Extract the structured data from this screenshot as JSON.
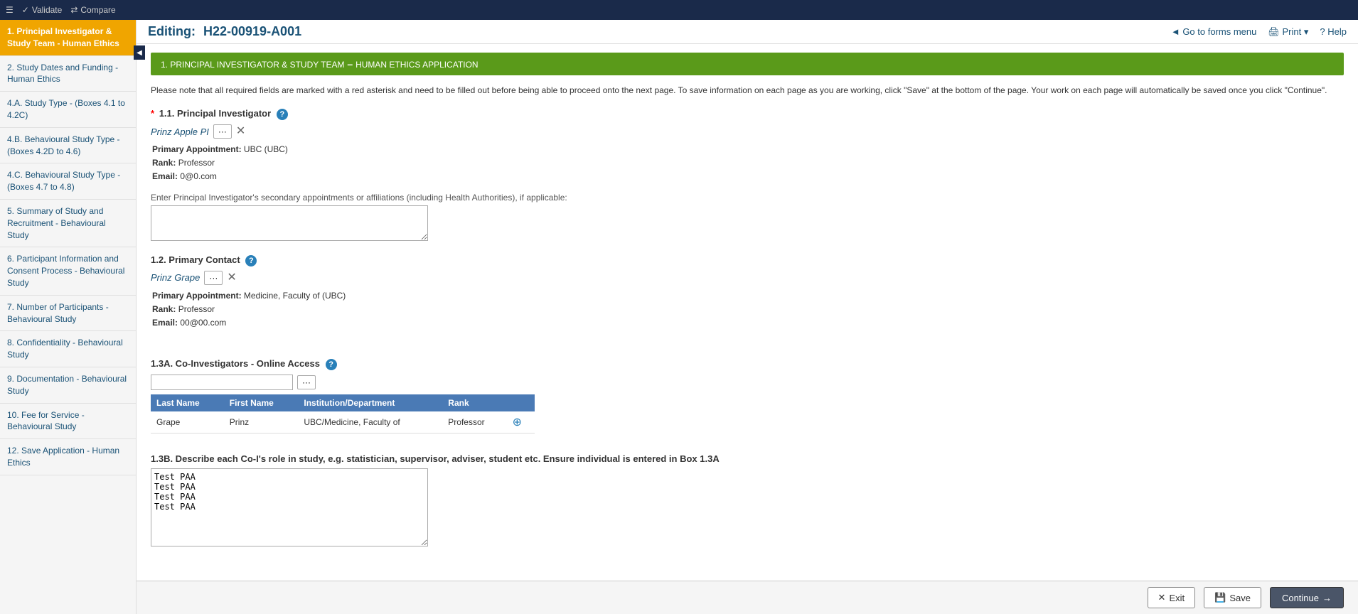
{
  "topbar": {
    "menu_icon": "☰",
    "validate_label": "Validate",
    "compare_label": "Compare",
    "collapse_icon": "◀"
  },
  "header": {
    "editing_prefix": "Editing:",
    "form_id": "H22-00919-A001",
    "go_to_forms_label": "Go to forms menu",
    "print_label": "Print",
    "help_label": "Help"
  },
  "sidebar": {
    "items": [
      {
        "id": "nav-1",
        "label": "1. Principal Investigator & Study Team - Human Ethics",
        "active": true
      },
      {
        "id": "nav-2",
        "label": "2. Study Dates and Funding - Human Ethics",
        "active": false
      },
      {
        "id": "nav-4a",
        "label": "4.A. Study Type - (Boxes 4.1 to 4.2C)",
        "active": false
      },
      {
        "id": "nav-4b",
        "label": "4.B. Behavioural Study Type - (Boxes 4.2D to 4.6)",
        "active": false
      },
      {
        "id": "nav-4c",
        "label": "4.C. Behavioural Study Type - (Boxes 4.7 to 4.8)",
        "active": false
      },
      {
        "id": "nav-5",
        "label": "5. Summary of Study and Recruitment - Behavioural Study",
        "active": false
      },
      {
        "id": "nav-6",
        "label": "6. Participant Information and Consent Process - Behavioural Study",
        "active": false
      },
      {
        "id": "nav-7",
        "label": "7. Number of Participants - Behavioural Study",
        "active": false
      },
      {
        "id": "nav-8",
        "label": "8. Confidentiality - Behavioural Study",
        "active": false
      },
      {
        "id": "nav-9",
        "label": "9. Documentation - Behavioural Study",
        "active": false
      },
      {
        "id": "nav-10",
        "label": "10. Fee for Service - Behavioural Study",
        "active": false
      },
      {
        "id": "nav-12",
        "label": "12. Save Application - Human Ethics",
        "active": false
      }
    ]
  },
  "section": {
    "title": "1. PRINCIPAL INVESTIGATOR & STUDY TEAM",
    "subtitle": "HUMAN ETHICS APPLICATION",
    "notice": "Please note that all required fields are marked with a red asterisk and need to be filled out before being able to proceed onto the next page. To save information on each page as you are working, click \"Save\" at the bottom of the page. Your work on each page will automatically be saved once you click \"Continue\"."
  },
  "principal_investigator": {
    "section_label": "1.1. Principal Investigator",
    "required": "*",
    "name": "Prinz Apple PI",
    "primary_appointment_label": "Primary Appointment:",
    "primary_appointment_value": "UBC (UBC)",
    "rank_label": "Rank:",
    "rank_value": "Professor",
    "email_label": "Email:",
    "email_value": "0@0.com",
    "secondary_label": "Enter Principal Investigator's secondary appointments or affiliations (including Health Authorities), if applicable:",
    "secondary_value": ""
  },
  "primary_contact": {
    "section_label": "1.2. Primary Contact",
    "name": "Prinz Grape",
    "primary_appointment_label": "Primary Appointment:",
    "primary_appointment_value": "Medicine, Faculty of (UBC)",
    "rank_label": "Rank:",
    "rank_value": "Professor",
    "email_label": "Email:",
    "email_value": "00@00.com"
  },
  "co_investigators": {
    "section_label": "1.3A. Co-Investigators - Online Access",
    "table_headers": [
      "Last Name",
      "First Name",
      "Institution/Department",
      "Rank"
    ],
    "rows": [
      {
        "last_name": "Grape",
        "first_name": "Prinz",
        "institution": "UBC/Medicine, Faculty of",
        "rank": "Professor"
      }
    ]
  },
  "co_inv_roles": {
    "section_label": "1.3B. Describe each Co-I's role in study, e.g. statistician, supervisor, adviser, student etc. Ensure individual is entered in Box 1.3A",
    "value": "Test PAA\nTest PAA\nTest PAA\nTest PAA"
  },
  "buttons": {
    "exit_label": "Exit",
    "save_label": "Save",
    "continue_label": "Continue"
  }
}
